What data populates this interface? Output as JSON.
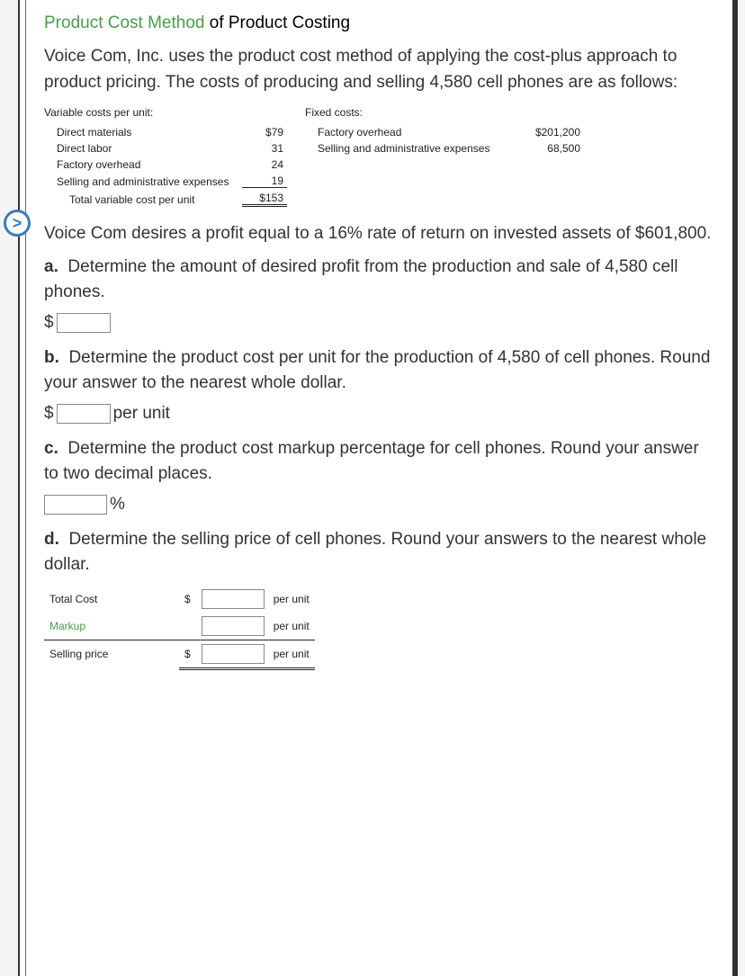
{
  "title": {
    "link": "Product Cost Method",
    "rest": " of Product Costing"
  },
  "intro": "Voice Com, Inc. uses the product cost method of applying the cost-plus approach to product pricing. The costs of producing and selling 4,580 cell phones are as follows:",
  "variable": {
    "header": "Variable costs per unit:",
    "rows": [
      {
        "label": "Direct materials",
        "value": "$79"
      },
      {
        "label": "Direct labor",
        "value": "31"
      },
      {
        "label": "Factory overhead",
        "value": "24"
      },
      {
        "label": "Selling and administrative expenses",
        "value": "19"
      }
    ],
    "total": {
      "label": "Total variable cost per unit",
      "value": "$153"
    }
  },
  "fixed": {
    "header": "Fixed costs:",
    "rows": [
      {
        "label": "Factory overhead",
        "value": "$201,200"
      },
      {
        "label": "Selling and administrative expenses",
        "value": "68,500"
      }
    ]
  },
  "profit_text": "Voice Com desires a profit equal to a 16% rate of return on invested assets of $601,800.",
  "parts": {
    "a": "Determine the amount of desired profit from the production and sale of 4,580 cell phones.",
    "b": "Determine the product cost per unit for the production of 4,580 of cell phones. Round your answer to the nearest whole dollar.",
    "c": "Determine the product cost markup percentage for cell phones. Round your answer to two decimal places.",
    "d": "Determine the selling price of cell phones. Round your answers to the nearest whole dollar."
  },
  "labels": {
    "dollar": "$",
    "per_unit": "per unit",
    "percent": "%",
    "bold_a": "a.",
    "bold_b": "b.",
    "bold_c": "c.",
    "bold_d": "d."
  },
  "d_table": {
    "total_cost": "Total Cost",
    "markup": "Markup",
    "selling_price": "Selling price"
  },
  "nav_badge": ">"
}
